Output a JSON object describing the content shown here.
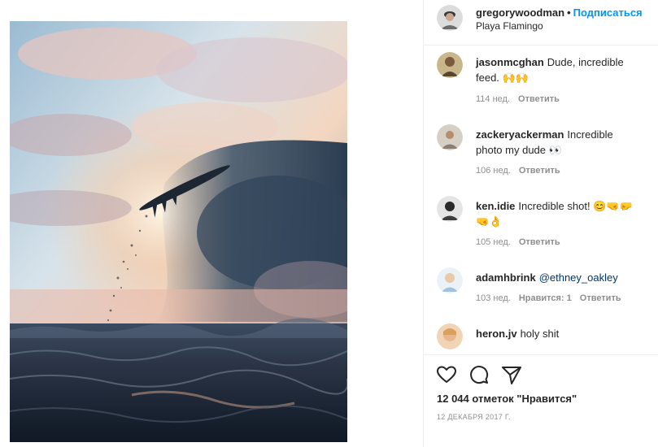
{
  "post": {
    "author": "gregorywoodman",
    "separator": "•",
    "follow_label": "Подписаться",
    "location": "Playa Flamingo"
  },
  "comments": [
    {
      "username": "jasonmcghan",
      "text": "Dude, incredible feed. 🙌🙌",
      "age": "114 нед.",
      "reply": "Ответить",
      "likes": ""
    },
    {
      "username": "zackeryackerman",
      "text": "Incredible photo my dude 👀",
      "age": "106 нед.",
      "reply": "Ответить",
      "likes": ""
    },
    {
      "username": "ken.idie",
      "text": "Incredible shot! 😊🤜🤛🤜👌",
      "age": "105 нед.",
      "reply": "Ответить",
      "likes": ""
    },
    {
      "username": "adamhbrink",
      "text": "",
      "mention": "@ethney_oakley",
      "age": "103 нед.",
      "reply": "Ответить",
      "likes": "Нравится: 1"
    },
    {
      "username": "heron.jv",
      "text": "holy shit"
    }
  ],
  "actions": {
    "like_icon": "heart-icon",
    "comment_icon": "comment-icon",
    "share_icon": "share-icon"
  },
  "likes_count": "12 044",
  "likes_suffix": "отметок \"Нравится\"",
  "date": "12 декабря 2017 г.",
  "colors": {
    "follow": "#0095f6",
    "muted": "#8e8e8e",
    "text": "#262626"
  }
}
